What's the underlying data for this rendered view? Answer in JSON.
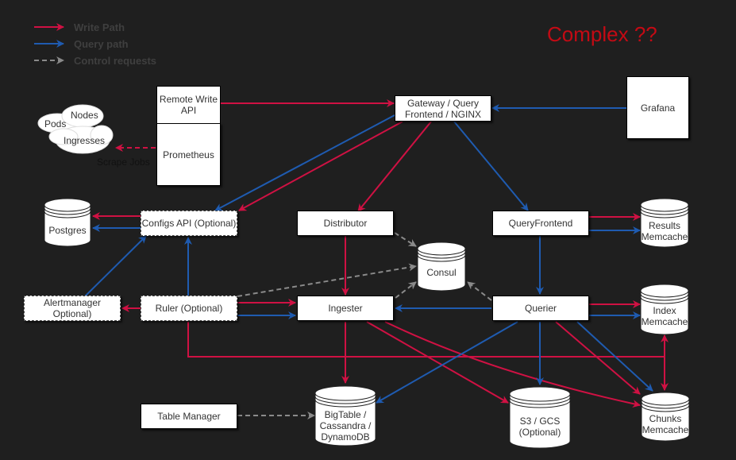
{
  "title": "Complex ??",
  "legend": [
    {
      "label": "Write Path",
      "color": "#cf1143",
      "style": "solid"
    },
    {
      "label": "Query path",
      "color": "#1f5bb0",
      "style": "solid"
    },
    {
      "label": "Control requests",
      "color": "#8a8a8a",
      "style": "dashed"
    }
  ],
  "colors": {
    "write": "#cf1143",
    "query": "#1f5bb0",
    "control": "#8a8a8a",
    "title": "#c40a14"
  },
  "nodes": {
    "remote_write": "Remote Write API",
    "prometheus": "Prometheus",
    "gateway": "Gateway / Query Frontend / NGINX",
    "grafana": "Grafana",
    "cloud": {
      "pods": "Pods",
      "nodes": "Nodes",
      "ingresses": "Ingresses"
    },
    "scrape_jobs": "Scrape Jobs",
    "postgres": "Postgres",
    "configs_api": "Configs API (Optional)",
    "distributor": "Distributor",
    "query_frontend": "QueryFrontend",
    "results_memcache": "Results Memcache",
    "consul": "Consul",
    "alertmanager": "Alertmanager Optional)",
    "ruler": "Ruler (Optional)",
    "ingester": "Ingester",
    "querier": "Querier",
    "index_memcache": "Index Memcache",
    "table_manager": "Table Manager",
    "bigtable": "BigTable / Cassandra / DynamoDB",
    "s3": "S3 / GCS (Optional)",
    "chunks_memcache": "Chunks Memcache"
  }
}
